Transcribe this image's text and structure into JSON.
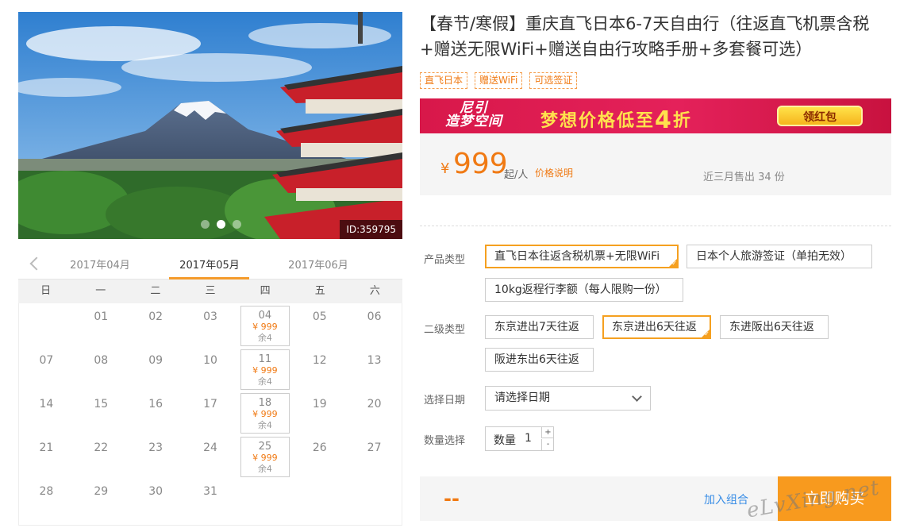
{
  "hero": {
    "id_label": "ID:359795",
    "dots": 3,
    "active_dot": 2
  },
  "calendar": {
    "months": [
      "2017年04月",
      "2017年05月",
      "2017年06月"
    ],
    "active_month": 1,
    "weekdays": [
      "日",
      "一",
      "二",
      "三",
      "四",
      "五",
      "六"
    ],
    "rows": [
      [
        {
          "d": ""
        },
        {
          "d": "01"
        },
        {
          "d": "02"
        },
        {
          "d": "03"
        },
        {
          "d": "04",
          "price": "¥ 999",
          "stock": "余4"
        },
        {
          "d": "05"
        },
        {
          "d": "06"
        }
      ],
      [
        {
          "d": "07"
        },
        {
          "d": "08"
        },
        {
          "d": "09"
        },
        {
          "d": "10"
        },
        {
          "d": "11",
          "price": "¥ 999",
          "stock": "余4"
        },
        {
          "d": "12"
        },
        {
          "d": "13"
        }
      ],
      [
        {
          "d": "14"
        },
        {
          "d": "15"
        },
        {
          "d": "16"
        },
        {
          "d": "17"
        },
        {
          "d": "18",
          "price": "¥ 999",
          "stock": "余4"
        },
        {
          "d": "19"
        },
        {
          "d": "20"
        }
      ],
      [
        {
          "d": "21"
        },
        {
          "d": "22"
        },
        {
          "d": "23"
        },
        {
          "d": "24"
        },
        {
          "d": "25",
          "price": "¥ 999",
          "stock": "余4"
        },
        {
          "d": "26"
        },
        {
          "d": "27"
        }
      ],
      [
        {
          "d": "28"
        },
        {
          "d": "29"
        },
        {
          "d": "30"
        },
        {
          "d": "31"
        },
        {
          "d": ""
        },
        {
          "d": ""
        },
        {
          "d": ""
        }
      ]
    ]
  },
  "product": {
    "title": "【春节/寒假】重庆直飞日本6-7天自由行（往返直飞机票含税+赠送无限WiFi+赠送自由行攻略手册+多套餐可选）",
    "tags": [
      "直飞日本",
      "赠送WiFi",
      "可选签证"
    ]
  },
  "banner": {
    "logo_line1": "尼引",
    "logo_line2": "造梦空间",
    "text_before": "梦想价格低至",
    "text_big": "4",
    "text_after": "折",
    "button": "领红包"
  },
  "price": {
    "symbol": "¥",
    "value": "999",
    "unit": "起/人",
    "explain_link": "价格说明",
    "sold": "近三月售出 34 份"
  },
  "options": {
    "product_type_label": "产品类型",
    "product_types": [
      "直飞日本往返含税机票+无限WiFi",
      "日本个人旅游签证（单拍无效）",
      "10kg返程行李额（每人限购一份）"
    ],
    "product_type_selected": 0,
    "sub_type_label": "二级类型",
    "sub_types": [
      "东京进出7天往返",
      "东京进出6天往返",
      "东进阪出6天往返",
      "阪进东出6天往返"
    ],
    "sub_type_selected": 1,
    "date_label": "选择日期",
    "date_placeholder": "请选择日期",
    "qty_label": "数量选择",
    "qty_inner_label": "数量",
    "qty_value": "1",
    "qty_up": "+",
    "qty_down": "-"
  },
  "buy": {
    "total": "--",
    "add_combo": "加入组合",
    "buy_now": "立即购买"
  },
  "watermark": "eLvXing.net"
}
